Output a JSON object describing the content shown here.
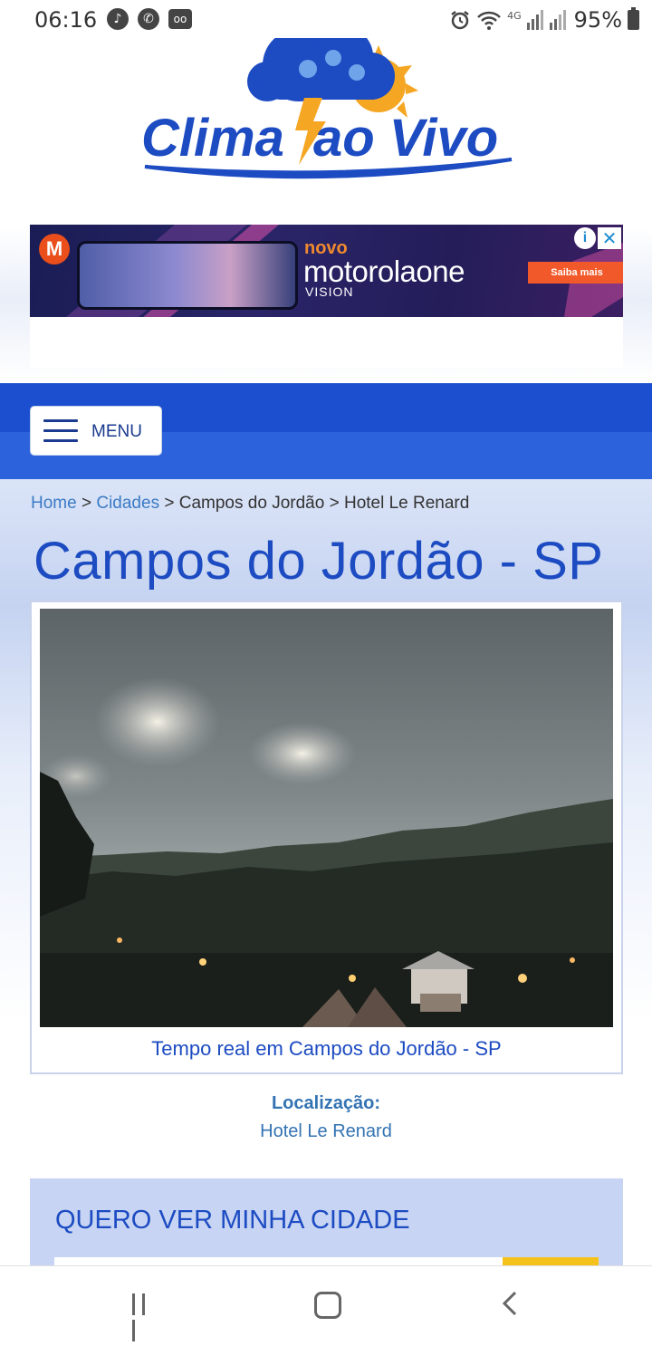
{
  "status_bar": {
    "time": "06:16",
    "battery": "95%",
    "network": "4G",
    "icons_left": [
      "music-app-icon",
      "whatsapp-icon",
      "voicemail-icon"
    ],
    "icons_right": [
      "alarm-icon",
      "wifi-icon",
      "signal-icon",
      "battery-icon"
    ]
  },
  "header": {
    "logo_text": "Clima ao Vivo",
    "logo_colors": {
      "brand_blue": "#1c4bc2",
      "sun_orange": "#f5a623"
    }
  },
  "ad": {
    "novo": "novo",
    "brand": "motorolaone",
    "model": "VISION",
    "cta": "Saiba mais",
    "logo": "M",
    "info_icon": "i",
    "close_icon": "✕"
  },
  "nav": {
    "menu_label": "MENU"
  },
  "breadcrumb": {
    "home": "Home",
    "sep": ">",
    "cities": "Cidades",
    "city": "Campos do Jordão",
    "place": "Hotel Le Renard"
  },
  "page": {
    "title": "Campos do Jordão - SP",
    "caption": "Tempo real em Campos do Jordão - SP",
    "location_label": "Localização:",
    "location_value": "Hotel Le Renard"
  },
  "city_search": {
    "title": "QUERO VER MINHA CIDADE"
  },
  "colors": {
    "nav_blue": "#1b4fcf",
    "link_blue": "#3b7bc6",
    "title_blue": "#1c4bc2",
    "panel_blue": "#c7d4f3",
    "button_yellow": "#f5c21b"
  }
}
